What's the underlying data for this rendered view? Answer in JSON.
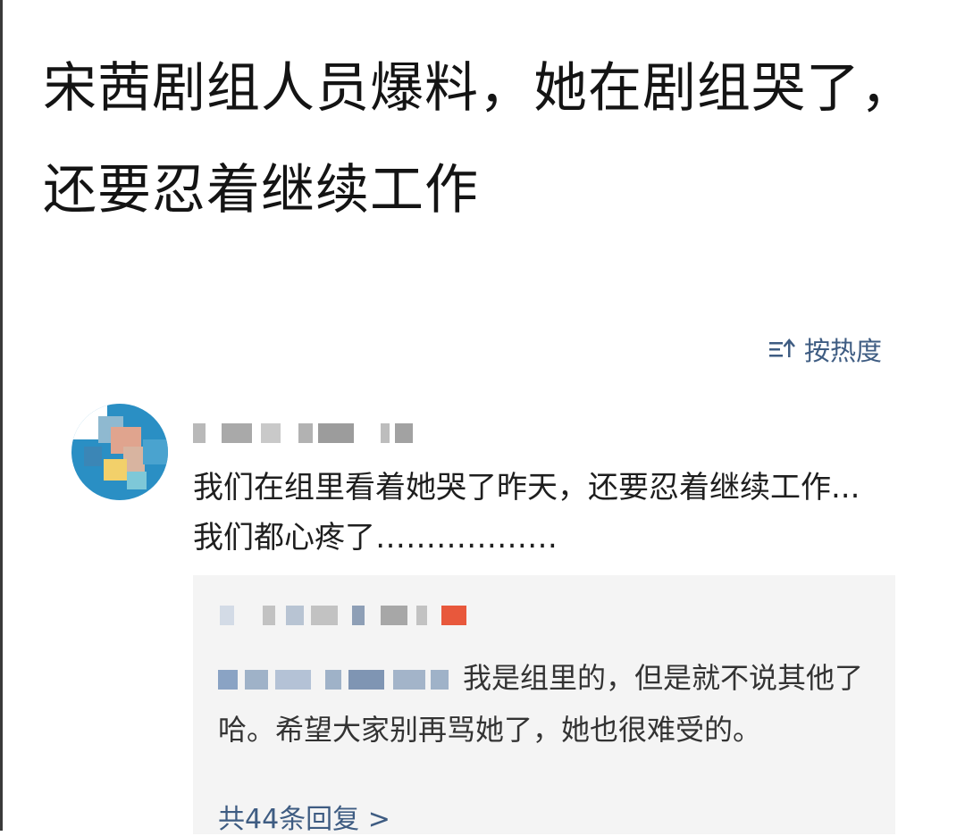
{
  "post": {
    "title": "宋茜剧组人员爆料，她在剧组哭了，还要忍着继续工作"
  },
  "sort": {
    "icon": "sort-desc-icon",
    "label": "按热度",
    "color": "#3e5c82"
  },
  "comment": {
    "text": "我们在组里看着她哭了昨天，还要忍着继续工作...我们都心疼了………………",
    "reply": {
      "text": "我是组里的，但是就不说其他了哈。希望大家别再骂她了，她也很难受的。",
      "view_all_label": "共44条回复 >"
    }
  }
}
